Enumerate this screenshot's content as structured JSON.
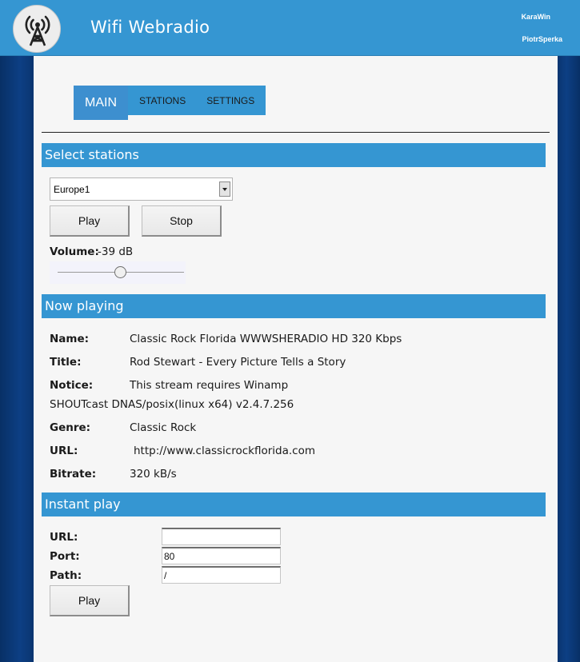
{
  "header": {
    "title": "Wifi Webradio",
    "authors": [
      "KaraWin",
      "PiotrSperka"
    ],
    "logo_icon": "radio-tower-icon"
  },
  "tabs": [
    {
      "label": "MAIN",
      "active": true
    },
    {
      "label": "STATIONS",
      "active": false
    },
    {
      "label": "SETTINGS",
      "active": false
    }
  ],
  "select_stations": {
    "heading": "Select stations",
    "selected_station": "Europe1",
    "play_label": "Play",
    "stop_label": "Stop",
    "volume_label": "Volume:",
    "volume_value": "-39 dB",
    "volume_slider_fraction": 0.5
  },
  "now_playing": {
    "heading": "Now playing",
    "name_label": "Name:",
    "name_value": "Classic Rock Florida WWWSHERADIO HD 320 Kbps",
    "title_label": "Title:",
    "title_value": "Rod Stewart - Every Picture Tells a Story",
    "notice_label": "Notice:",
    "notice_value_line1": "This stream requires Winamp",
    "notice_value_line2": "SHOUTcast DNAS/posix(linux x64) v2.4.7.256",
    "genre_label": "Genre:",
    "genre_value": "Classic Rock",
    "url_label": "URL:",
    "url_value": "http://www.classicrockflorida.com",
    "bitrate_label": "Bitrate:",
    "bitrate_value": "320 kB/s"
  },
  "instant_play": {
    "heading": "Instant play",
    "url_label": "URL:",
    "url_value": "",
    "port_label": "Port:",
    "port_value": "80",
    "path_label": "Path:",
    "path_value": "/",
    "play_label": "Play"
  },
  "colors": {
    "header_bg": "#3596d2",
    "section_bar": "#3596d2",
    "side_bg": "#0c3a78",
    "content_bg": "#f6f6f6"
  }
}
